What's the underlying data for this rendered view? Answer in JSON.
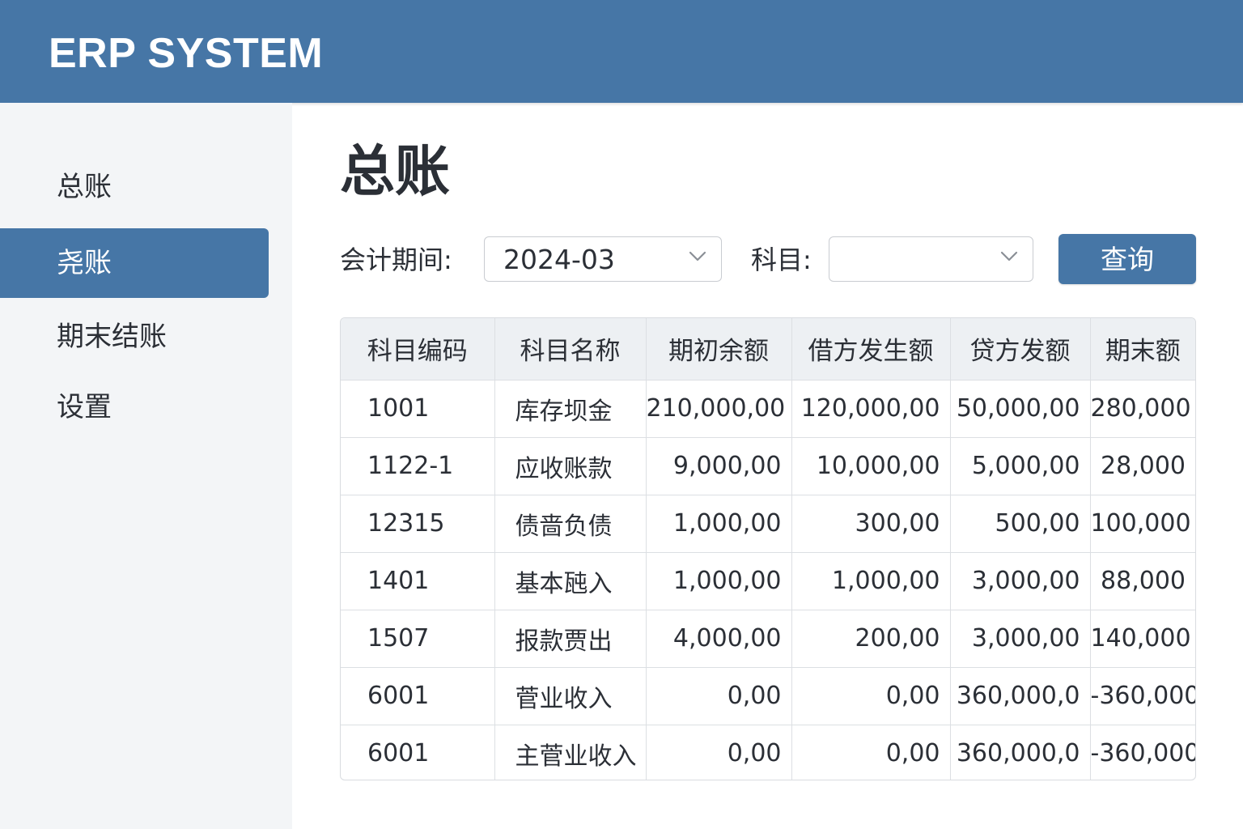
{
  "app": {
    "brand": "ERP SYSTEM"
  },
  "sidebar": {
    "items": [
      {
        "label": "总账",
        "active": false
      },
      {
        "label": "尧账",
        "active": true
      },
      {
        "label": "期末结账",
        "active": false
      },
      {
        "label": "设置",
        "active": false
      }
    ]
  },
  "main": {
    "title": "总账",
    "filters": {
      "period_label": "会计期间:",
      "period_value": "2024-03",
      "subject_label": "科目:",
      "subject_value": "",
      "query_label": "查询"
    },
    "table": {
      "columns": [
        "科目编码",
        "科目名称",
        "期初余额",
        "借方发生额",
        "贷方发额",
        "期末额"
      ],
      "rows": [
        [
          "1001",
          "库存坝金",
          "210,000,00",
          "120,000,00",
          "50,000,00",
          "280,000"
        ],
        [
          "1122-1",
          "应收账款",
          "9,000,00",
          "10,000,00",
          "5,000,00",
          "28,000"
        ],
        [
          "12315",
          "债啬负债",
          "1,000,00",
          "300,00",
          "500,00",
          "100,000"
        ],
        [
          "1401",
          "基本瓲入",
          "1,000,00",
          "1,000,00",
          "3,000,00",
          "88,000"
        ],
        [
          "1507",
          "报款贾出",
          "4,000,00",
          "200,00",
          "3,000,00",
          "140,000"
        ],
        [
          "6001",
          "菅业收入",
          "0,00",
          "0,00",
          "360,000,0",
          "-360,000"
        ],
        [
          "6001",
          "主菅业收入",
          "0,00",
          "0,00",
          "360,000,0",
          "-360,000"
        ]
      ]
    }
  },
  "colors": {
    "primary": "#4676a6",
    "sidebar_bg": "#f3f5f7",
    "header_row_bg": "#edf0f3",
    "text": "#2b2f36"
  },
  "icons": {
    "select_arrow": "chevron-down-icon"
  }
}
